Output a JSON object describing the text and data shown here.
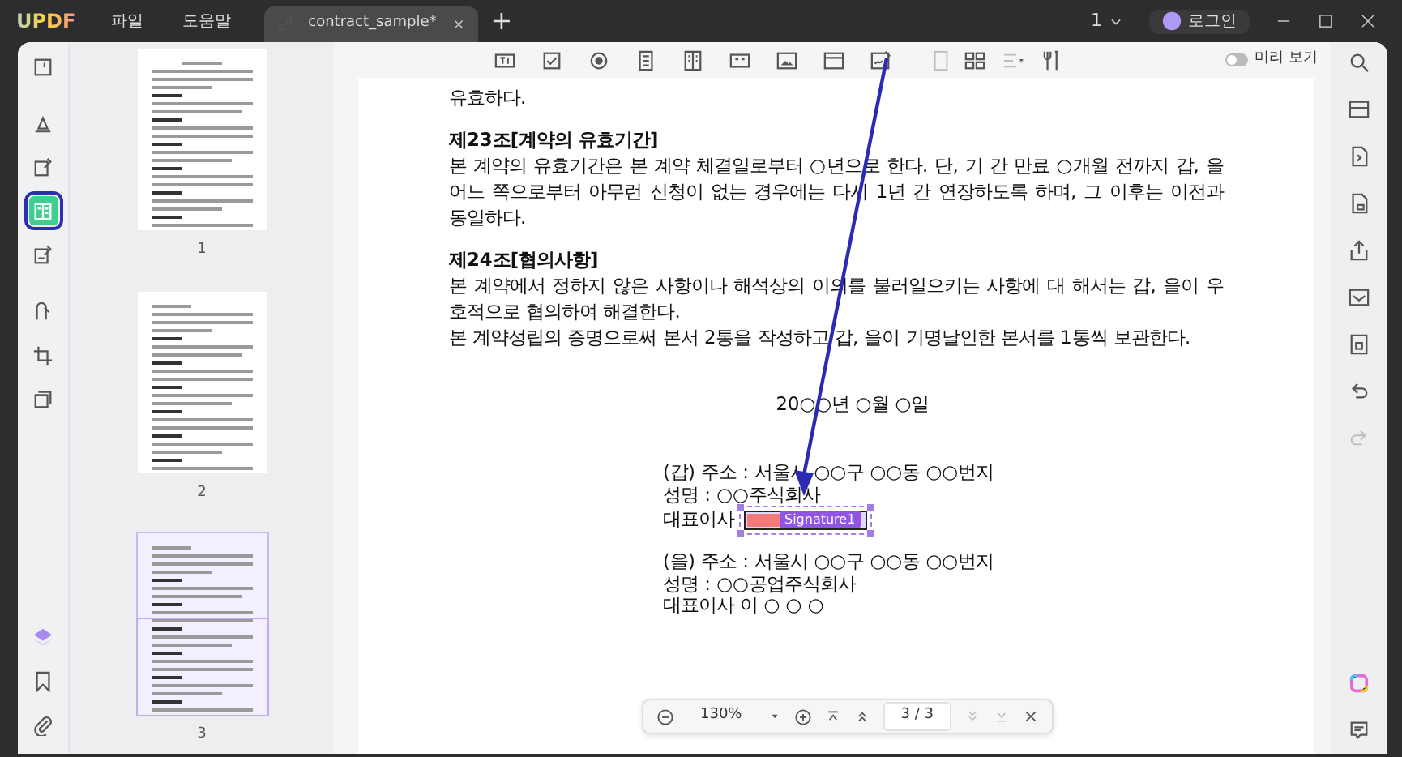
{
  "title_bar": {
    "logo": "UPDF",
    "menus": [
      "파일",
      "도움말"
    ],
    "tab": {
      "label": "contract_sample*",
      "selected": true
    },
    "new_tab": "+",
    "window_count": "1",
    "login": "로그인"
  },
  "left_rail": [
    {
      "selected": false
    },
    {
      "selected": false
    },
    {
      "selected": false
    },
    {
      "selected": true
    },
    {
      "selected": false
    },
    {
      "selected": false
    },
    {
      "selected": false
    },
    {
      "selected": false
    }
  ],
  "thumbnails": [
    {
      "label": "1",
      "selected": false
    },
    {
      "label": "2",
      "selected": false
    },
    {
      "label": "3",
      "selected": true
    }
  ],
  "toolbar": {
    "preview_toggle": {
      "label": "미리 보기",
      "on": false
    }
  },
  "document": {
    "paragraphs": [
      {
        "kind": "text",
        "text": "유효하다."
      },
      {
        "kind": "heading",
        "text": "제23조[계약의 유효기간]"
      },
      {
        "kind": "text",
        "text": "본 계약의 유효기간은 본 계약 체결일로부터 ○년으로 한다. 단, 기 간 만료 ○개월 전까지 갑, 을 어느 쪽으로부터 아무런 신청이 없는 경우에는 다시 1년 간 연장하도록 하며, 그 이후는 이전과 동일하다."
      },
      {
        "kind": "heading",
        "text": "제24조[협의사항]"
      },
      {
        "kind": "text",
        "text": "본 계약에서 정하지 않은 사항이나 해석상의 이의를 불러일으키는 사항에 대 해서는 갑, 을이 우호적으로 협의하여 해결한다."
      },
      {
        "kind": "text",
        "text": "본 계약성립의 증명으로써 본서 2통을 작성하고 갑, 을이 기명날인한 본서를 1통씩 보관한다."
      },
      {
        "kind": "date",
        "text": "20○○년 ○월 ○일"
      }
    ],
    "parties": [
      {
        "lines": [
          "(갑) 주소 : 서울시 ○○구 ○○동 ○○번지",
          "성명 : ○○주식회사",
          "대표이사"
        ],
        "signature_field": "Signature1"
      },
      {
        "lines": [
          "(을) 주소 : 서울시 ○○구 ○○동 ○○번지",
          "성명 : ○○공업주식회사",
          "대표이사 이 ○ ○ ○"
        ]
      }
    ]
  },
  "zoom_bar": {
    "zoom": "130%",
    "page": "3 / 3"
  }
}
